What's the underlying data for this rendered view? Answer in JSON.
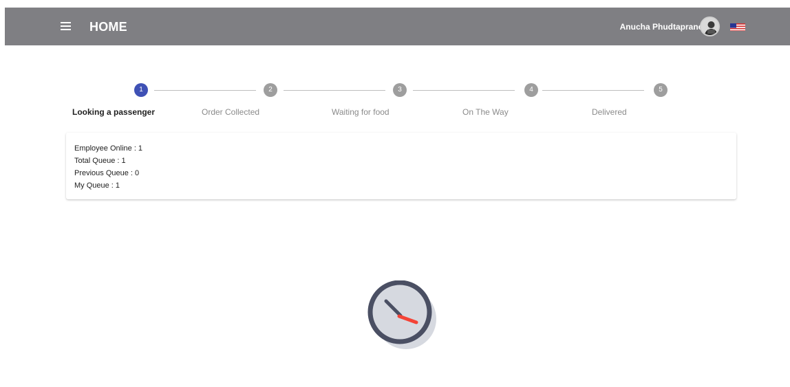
{
  "header": {
    "title": "HOME",
    "user_name": "Anucha Phudtapranee",
    "menu_icon": "menu-icon",
    "avatar_icon": "avatar",
    "flag_icon": "us-flag-icon",
    "bar_color": "#7f7f83"
  },
  "stepper": {
    "active_color": "#3f51b5",
    "inactive_color": "#9e9e9e",
    "steps": [
      {
        "number": "1",
        "label": "Looking a passenger",
        "active": true
      },
      {
        "number": "2",
        "label": "Order Collected",
        "active": false
      },
      {
        "number": "3",
        "label": "Waiting for food",
        "active": false
      },
      {
        "number": "4",
        "label": "On The Way",
        "active": false
      },
      {
        "number": "5",
        "label": "Delivered",
        "active": false
      }
    ]
  },
  "queue_info": {
    "employee_online": "Employee Online : 1",
    "total_queue": "Total Queue : 1",
    "previous_queue": "Previous Queue : 0",
    "my_queue": "My Queue : 1"
  },
  "waiting": {
    "icon": "clock-icon",
    "hand_color": "#f44336",
    "face_color": "#d6d9e0",
    "rim_color": "#4a4f63"
  }
}
